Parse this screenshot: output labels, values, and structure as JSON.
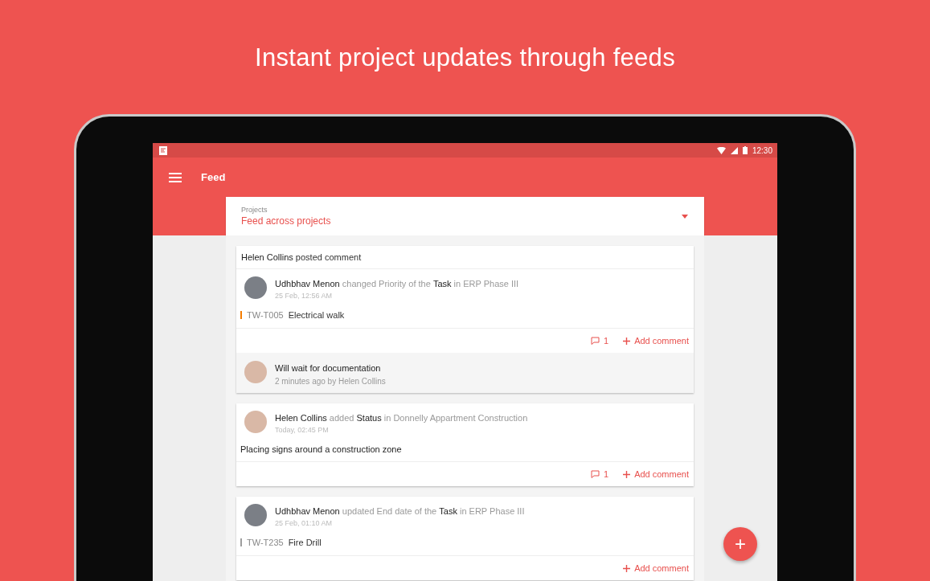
{
  "headline": "Instant project updates through feeds",
  "status_bar": {
    "time": "12:30"
  },
  "app_bar": {
    "title": "Feed"
  },
  "project_picker": {
    "label": "Projects",
    "value": "Feed across projects"
  },
  "feed": [
    {
      "kind": "task",
      "header": "**Helen Collins** posted comment",
      "activity": "**Udhbhav Menon** changed Priority of the **Task** in ERP Phase III",
      "time": "25 Feb, 12:56 AM",
      "task_id": "TW-T005",
      "task_title": "Electrical walk",
      "color": "#f57c00",
      "comment_count": "1",
      "add_comment": "Add comment",
      "comment": {
        "text": "Will wait for documentation",
        "meta": "2 minutes ago by Helen Collins"
      }
    },
    {
      "kind": "status",
      "activity": "**Helen Collins** added **Status** in Donnelly Appartment Construction",
      "time": "Today, 02:45 PM",
      "body": "Placing signs around a construction zone",
      "comment_count": "1",
      "add_comment": "Add comment"
    },
    {
      "kind": "task",
      "activity": "**Udhbhav Menon** updated End date of the **Task** in ERP Phase III",
      "time": "25 Feb, 01:10 AM",
      "task_id": "TW-T235",
      "task_title": "Fire Drill",
      "color": "#9e9e9e",
      "add_comment": "Add comment"
    }
  ],
  "fab": {
    "label": "+"
  }
}
